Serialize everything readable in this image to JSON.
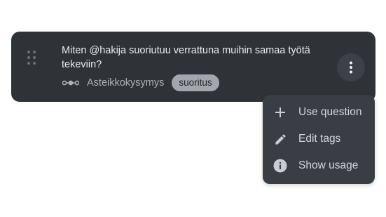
{
  "question_card": {
    "text": "Miten @hakija suoriutuu verrattuna muihin samaa työtä tekeviin?",
    "type_icon": "scale-icon",
    "type_label": "Asteikkokysymys",
    "tag": "suoritus",
    "more_icon": "more-vertical-icon"
  },
  "menu": {
    "items": [
      {
        "icon": "plus-icon",
        "label": "Use question"
      },
      {
        "icon": "pencil-icon",
        "label": "Edit tags"
      },
      {
        "icon": "info-icon",
        "label": "Show usage"
      }
    ]
  },
  "colors": {
    "card_bg": "#2f3338",
    "menu_bg": "#3a3e44",
    "chip_bg": "#a3a7ad",
    "text_primary": "#e9ebee",
    "text_secondary": "#aeb2b8"
  }
}
